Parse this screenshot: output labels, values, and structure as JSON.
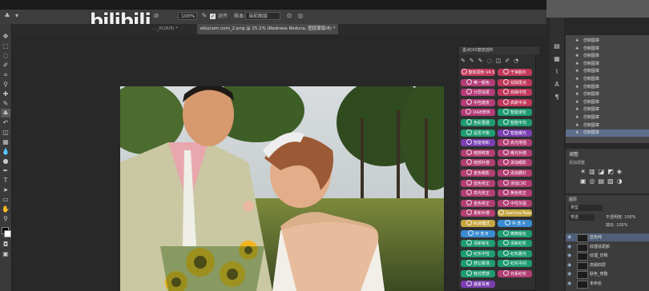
{
  "watermark": {
    "logo_text": "bilibili"
  },
  "options_bar": {
    "zoom_value": "100%",
    "checkbox_label": "对齐",
    "sample_select": "当前图层",
    "opacity_label": "100%"
  },
  "tabs": [
    {
      "label": "…_RGB/8) *",
      "active": false
    },
    {
      "label": "ebiycom.com_2.png @ 25.1% (Redness Reduce, 图层蒙版/8) *",
      "active": true
    }
  ],
  "plugin_panel": {
    "title": "墨点DIX磨皮插件",
    "buttons": [
      {
        "label": "整体调色 V4.5",
        "color": "#c0395b"
      },
      {
        "label": "干净胶片",
        "color": "#c0395b"
      },
      {
        "label": "唯一颜色",
        "color": "#b33d77"
      },
      {
        "label": "祛除斑点",
        "color": "#c0395b"
      },
      {
        "label": "分层祛斑",
        "color": "#b33d77"
      },
      {
        "label": "双曲中性",
        "color": "#c0395b"
      },
      {
        "label": "中性磨皮",
        "color": "#b33d77"
      },
      {
        "label": "高斯平涂",
        "color": "#c0395b"
      },
      {
        "label": "D&B修饰",
        "color": "#b33d77"
      },
      {
        "label": "智能液化",
        "color": "#1f9b73"
      },
      {
        "label": "色彩重建",
        "color": "#1f9b73"
      },
      {
        "label": "智能平均",
        "color": "#1f9b73"
      },
      {
        "label": "是否平衡",
        "color": "#1f9b73"
      },
      {
        "label": "智能曝光",
        "color": "#7a3fb0"
      },
      {
        "label": "智能饱和",
        "color": "#7a3fb0"
      },
      {
        "label": "高光增强",
        "color": "#b23f73"
      },
      {
        "label": "暗部修复",
        "color": "#b23f73"
      },
      {
        "label": "曝光补偿",
        "color": "#b23f73"
      },
      {
        "label": "暗部补偿",
        "color": "#b23f73"
      },
      {
        "label": "添加眼影",
        "color": "#b23f73"
      },
      {
        "label": "金色眼影",
        "color": "#b23f73"
      },
      {
        "label": "添加腮红",
        "color": "#b23f73"
      },
      {
        "label": "蓝色校正",
        "color": "#b23f73"
      },
      {
        "label": "添加口红",
        "color": "#b23f73"
      },
      {
        "label": "高光校正",
        "color": "#b23f73"
      },
      {
        "label": "黄色校正",
        "color": "#b23f73"
      },
      {
        "label": "金色校正",
        "color": "#b23f73"
      },
      {
        "label": "中性灰提",
        "color": "#b23f73"
      },
      {
        "label": "柔和补偿",
        "color": "#b23f73"
      },
      {
        "label": "Gamma Raw",
        "color": "#c6a642"
      },
      {
        "label": "RGB模式",
        "color": "#c6a642"
      },
      {
        "label": "冲 洗 A",
        "color": "#3a8bd0"
      },
      {
        "label": "冲 洗 B",
        "color": "#3a8bd0"
      },
      {
        "label": "微微锐化",
        "color": "#1f9b73"
      },
      {
        "label": "清新锐化",
        "color": "#1f9b73"
      },
      {
        "label": "清新纪实",
        "color": "#1f9b73"
      },
      {
        "label": "纪实中性",
        "color": "#1f9b73"
      },
      {
        "label": "纪实晨光",
        "color": "#1f9b73"
      },
      {
        "label": "梦幻柔场",
        "color": "#1f9b73"
      },
      {
        "label": "纪实中间",
        "color": "#1f9b73"
      },
      {
        "label": "韩式质感",
        "color": "#1f9b73"
      },
      {
        "label": "日系纪实",
        "color": "#b23f73"
      },
      {
        "label": "盛夏青黄",
        "color": "#7a3fb0"
      }
    ]
  },
  "history_panel": {
    "items": [
      "仿制图章",
      "仿制图章",
      "仿制图章",
      "仿制图章",
      "仿制图章",
      "仿制图章",
      "仿制图章",
      "仿制图章",
      "仿制图章",
      "仿制图章",
      "仿制图章",
      "仿制图章",
      "仿制图章"
    ]
  },
  "adjustments_panel": {
    "title": "调整",
    "subtitle": "添加调整"
  },
  "layers_panel": {
    "mode": "穿透",
    "opacity_label": "不透明度: 100%",
    "fill_label": "填充: 100%",
    "layers": [
      "蓝色纯",
      "纹理祛斑颜",
      "纹理_仿制",
      "高频四层",
      "肤色_修整",
      "未命名"
    ]
  }
}
